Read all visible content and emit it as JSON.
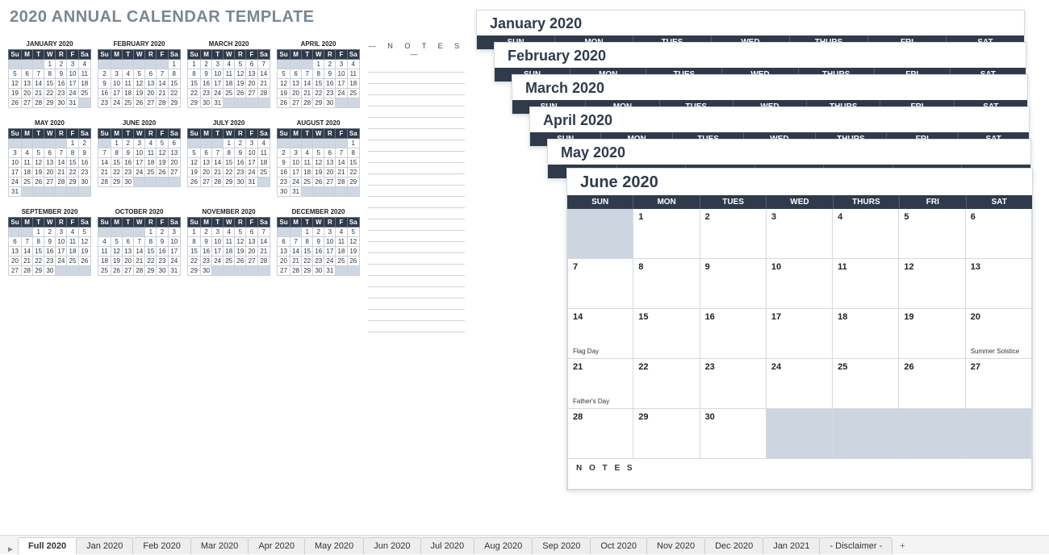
{
  "title": "2020 ANNUAL CALENDAR TEMPLATE",
  "notes_label": "— N O T E S —",
  "day_short": [
    "Su",
    "M",
    "T",
    "W",
    "R",
    "F",
    "Sa"
  ],
  "day_med": [
    "SUN",
    "MON",
    "TUES",
    "WED",
    "THURS",
    "FRI",
    "SAT"
  ],
  "mini_months": [
    {
      "name": "JANUARY 2020",
      "start": 3,
      "days": 31
    },
    {
      "name": "FEBRUARY 2020",
      "start": 6,
      "days": 29
    },
    {
      "name": "MARCH 2020",
      "start": 0,
      "days": 31
    },
    {
      "name": "APRIL 2020",
      "start": 3,
      "days": 30
    },
    {
      "name": "MAY 2020",
      "start": 5,
      "days": 31
    },
    {
      "name": "JUNE 2020",
      "start": 1,
      "days": 30
    },
    {
      "name": "JULY 2020",
      "start": 3,
      "days": 31
    },
    {
      "name": "AUGUST 2020",
      "start": 6,
      "days": 31
    },
    {
      "name": "SEPTEMBER 2020",
      "start": 2,
      "days": 30
    },
    {
      "name": "OCTOBER 2020",
      "start": 4,
      "days": 31
    },
    {
      "name": "NOVEMBER 2020",
      "start": 0,
      "days": 30
    },
    {
      "name": "DECEMBER 2020",
      "start": 2,
      "days": 31
    }
  ],
  "sheets": [
    {
      "title": "January 2020"
    },
    {
      "title": "February 2020"
    },
    {
      "title": "March 2020"
    },
    {
      "title": "April 2020"
    },
    {
      "title": "May 2020"
    }
  ],
  "june": {
    "title": "June 2020",
    "start": 1,
    "days": 30,
    "events": {
      "14": "Flag Day",
      "20": "Summer Solstice",
      "21": "Father's Day"
    },
    "notes_label": "N O T E S"
  },
  "tabs": [
    "Full 2020",
    "Jan 2020",
    "Feb 2020",
    "Mar 2020",
    "Apr 2020",
    "May 2020",
    "Jun 2020",
    "Jul 2020",
    "Aug 2020",
    "Sep 2020",
    "Oct 2020",
    "Nov 2020",
    "Dec 2020",
    "Jan 2021",
    "- Disclaimer -"
  ],
  "active_tab": 0,
  "add_tab_label": "+"
}
